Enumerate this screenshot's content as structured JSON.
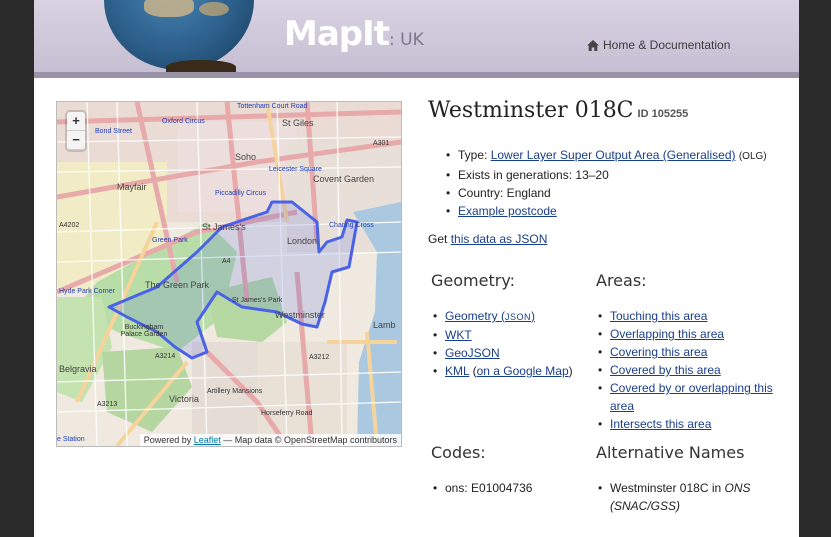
{
  "header": {
    "logo": "MapIt",
    "logo_sub": ": UK",
    "nav_home": "Home & Documentation"
  },
  "map": {
    "zoom_in": "+",
    "zoom_out": "−",
    "attribution_prefix": "Powered by",
    "attribution_link": "Leaflet",
    "attribution_suffix": "— Map data © OpenStreetMap contributors",
    "labels": {
      "tottenham": "Tottenham Court Road",
      "oxford": "Oxford Circus",
      "bond": "Bond Street",
      "stgiles": "St Giles",
      "soho": "Soho",
      "covent": "Covent Garden",
      "leicester": "Leicester Square",
      "mayfair": "Mayfair",
      "piccadilly": "Piccadilly Circus",
      "stjames": "St James's",
      "london": "London",
      "charing": "Charing Cross",
      "greenpark": "Green Park",
      "greenpark2": "The Green Park",
      "hyde": "Hyde Park Corner",
      "stjamespark": "St James's Park",
      "westminster": "Westminster",
      "buckingham": "Buckingham Palace Garden",
      "belgravia": "Belgravia",
      "victoria": "Victoria",
      "a3214": "A3214",
      "a3212": "A3212",
      "a3213": "A3213",
      "a4": "A4",
      "a4202": "A4202",
      "a301": "A301",
      "lambeth": "Lamb",
      "station": "e Station",
      "horseferry": "Horseferry Road",
      "artillery": "Artillery Mansions"
    }
  },
  "area": {
    "name": "Westminster 018C",
    "id_label": "ID 105255"
  },
  "info": {
    "type_label": "Type: ",
    "type_link": "Lower Layer Super Output Area (Generalised)",
    "type_code": "(OLG)",
    "generations": "Exists in generations: 13–20",
    "country": "Country: England",
    "postcode": "Example postcode"
  },
  "json_line": {
    "prefix": "Get ",
    "link": "this data as JSON"
  },
  "geometry": {
    "heading": "Geometry:",
    "geometry_link": "Geometry (",
    "json_small": "JSON",
    "geometry_close": ")",
    "wkt": "WKT",
    "geojson": "GeoJSON",
    "kml": "KML",
    "google_open": " (",
    "google": "on a Google Map",
    "google_close": ")"
  },
  "areas": {
    "heading": "Areas:",
    "items": [
      "Touching this area",
      "Overlapping this area",
      "Covering this area",
      "Covered by this area",
      "Covered by or overlapping this area",
      "Intersects this area"
    ]
  },
  "codes": {
    "heading": "Codes:",
    "item": "ons: E01004736"
  },
  "alt": {
    "heading": "Alternative Names",
    "name": "Westminster 018C in ",
    "source": "ONS (SNAC/GSS)"
  },
  "colors": {
    "boundary": "#4a63e6",
    "link": "#1a3f8a",
    "header": "#c6bfd3"
  }
}
